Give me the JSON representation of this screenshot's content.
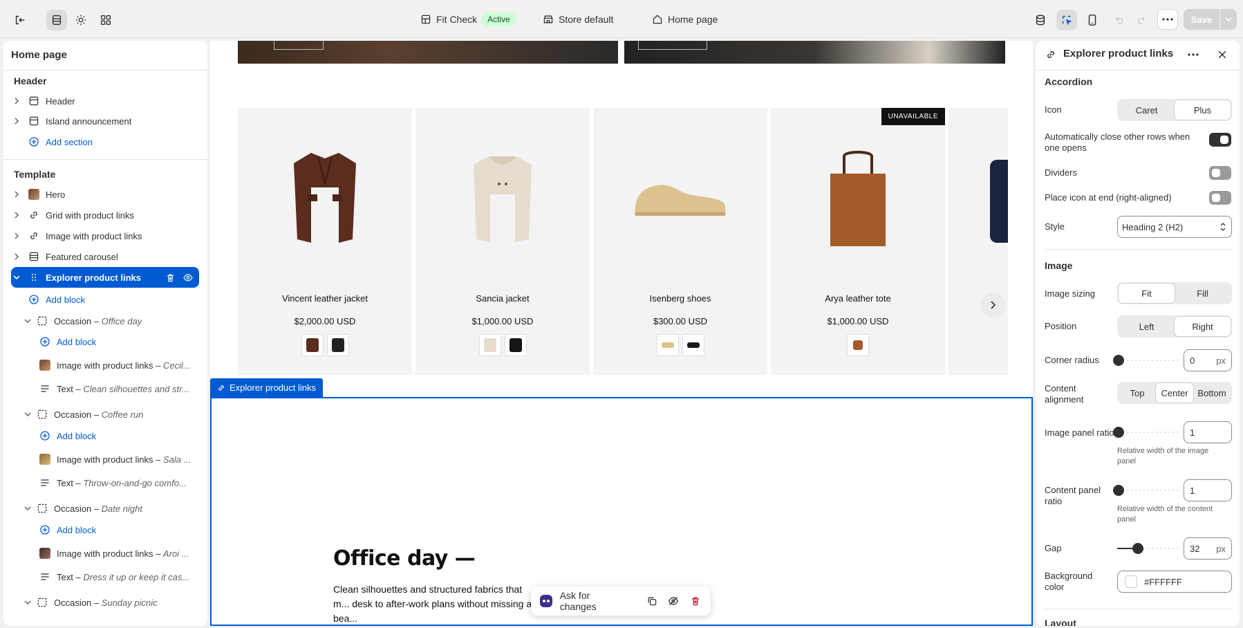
{
  "topbar": {
    "center_items": [
      {
        "label": "Fit Check",
        "badge": "Active"
      },
      {
        "label": "Store default"
      },
      {
        "label": "Home page"
      }
    ],
    "save_label": "Save"
  },
  "sidebar": {
    "title": "Home page",
    "header_section": "Header",
    "header_items": [
      "Header",
      "Island announcement"
    ],
    "add_section": "Add section",
    "template_section": "Template",
    "template_items": [
      "Hero",
      "Grid with product links",
      "Image with product links",
      "Featured carousel"
    ],
    "selected": "Explorer product links",
    "add_block": "Add block",
    "occasions": [
      {
        "name": "Occasion",
        "sub": "Office day",
        "image": "Image with product links",
        "image_sub": "Cecil...",
        "text": "Text",
        "text_sub": "Clean silhouettes and str..."
      },
      {
        "name": "Occasion",
        "sub": "Coffee run",
        "image": "Image with product links",
        "image_sub": "Sala ...",
        "text": "Text",
        "text_sub": "Throw-on-and-go comfo..."
      },
      {
        "name": "Occasion",
        "sub": "Date night",
        "image": "Image with product links",
        "image_sub": "Aroi ...",
        "text": "Text",
        "text_sub": "Dress it up or keep it cas..."
      },
      {
        "name": "Occasion",
        "sub": "Sunday picnic"
      }
    ]
  },
  "canvas": {
    "products": [
      {
        "name": "Vincent leather jacket",
        "price": "$2,000.00 USD",
        "color": "#5a2d1f",
        "swatches": [
          "#5a2d1f",
          "#222222"
        ]
      },
      {
        "name": "Sancia jacket",
        "price": "$1,000.00 USD",
        "color": "#e5dccb",
        "swatches": [
          "#e5dccb",
          "#151515"
        ]
      },
      {
        "name": "Isenberg shoes",
        "price": "$300.00 USD",
        "color": "#dcc28e",
        "swatches": [
          "#dcc28e",
          "#1a1a1a"
        ]
      },
      {
        "name": "Arya leather tote",
        "price": "$1,000.00 USD",
        "color": "#a55a2a",
        "swatches": [
          "#a55a2a"
        ],
        "badge": "UNAVAILABLE"
      }
    ],
    "section_tag": "Explorer product links",
    "office_title": "Office day —",
    "office_text": "Clean silhouettes and structured fabrics that m... desk to after-work plans without missing a bea..."
  },
  "floatbar": {
    "ask_label": "Ask for changes"
  },
  "panel": {
    "title": "Explorer product links",
    "accordion": {
      "heading": "Accordion",
      "icon_label": "Icon",
      "icon_options": [
        "Caret",
        "Plus"
      ],
      "icon_selected": "Plus",
      "auto_close_label": "Automatically close other rows when one opens",
      "auto_close": true,
      "dividers_label": "Dividers",
      "dividers": false,
      "place_icon_label": "Place icon at end (right-aligned)",
      "place_icon": false,
      "style_label": "Style",
      "style_value": "Heading 2 (H2)"
    },
    "image": {
      "heading": "Image",
      "sizing_label": "Image sizing",
      "sizing_options": [
        "Fit",
        "Fill"
      ],
      "sizing_selected": "Fit",
      "position_label": "Position",
      "position_options": [
        "Left",
        "Right"
      ],
      "position_selected": "Right",
      "corner_label": "Corner radius",
      "corner_value": "0",
      "corner_fraction": 0.0,
      "unit": "px",
      "content_align_label": "Content alignment",
      "align_options": [
        "Top",
        "Center",
        "Bottom"
      ],
      "align_selected": "Center",
      "image_ratio_label": "Image panel ratio",
      "image_ratio_value": "1",
      "image_ratio_fraction": 0.0,
      "image_ratio_help": "Relative width of the image panel",
      "content_ratio_label": "Content panel ratio",
      "content_ratio_value": "1",
      "content_ratio_fraction": 0.0,
      "content_ratio_help": "Relative width of the content panel",
      "gap_label": "Gap",
      "gap_value": "32",
      "gap_fraction": 0.32,
      "bg_label": "Background color",
      "bg_value": "#FFFFFF"
    },
    "next_heading": "Layout"
  }
}
